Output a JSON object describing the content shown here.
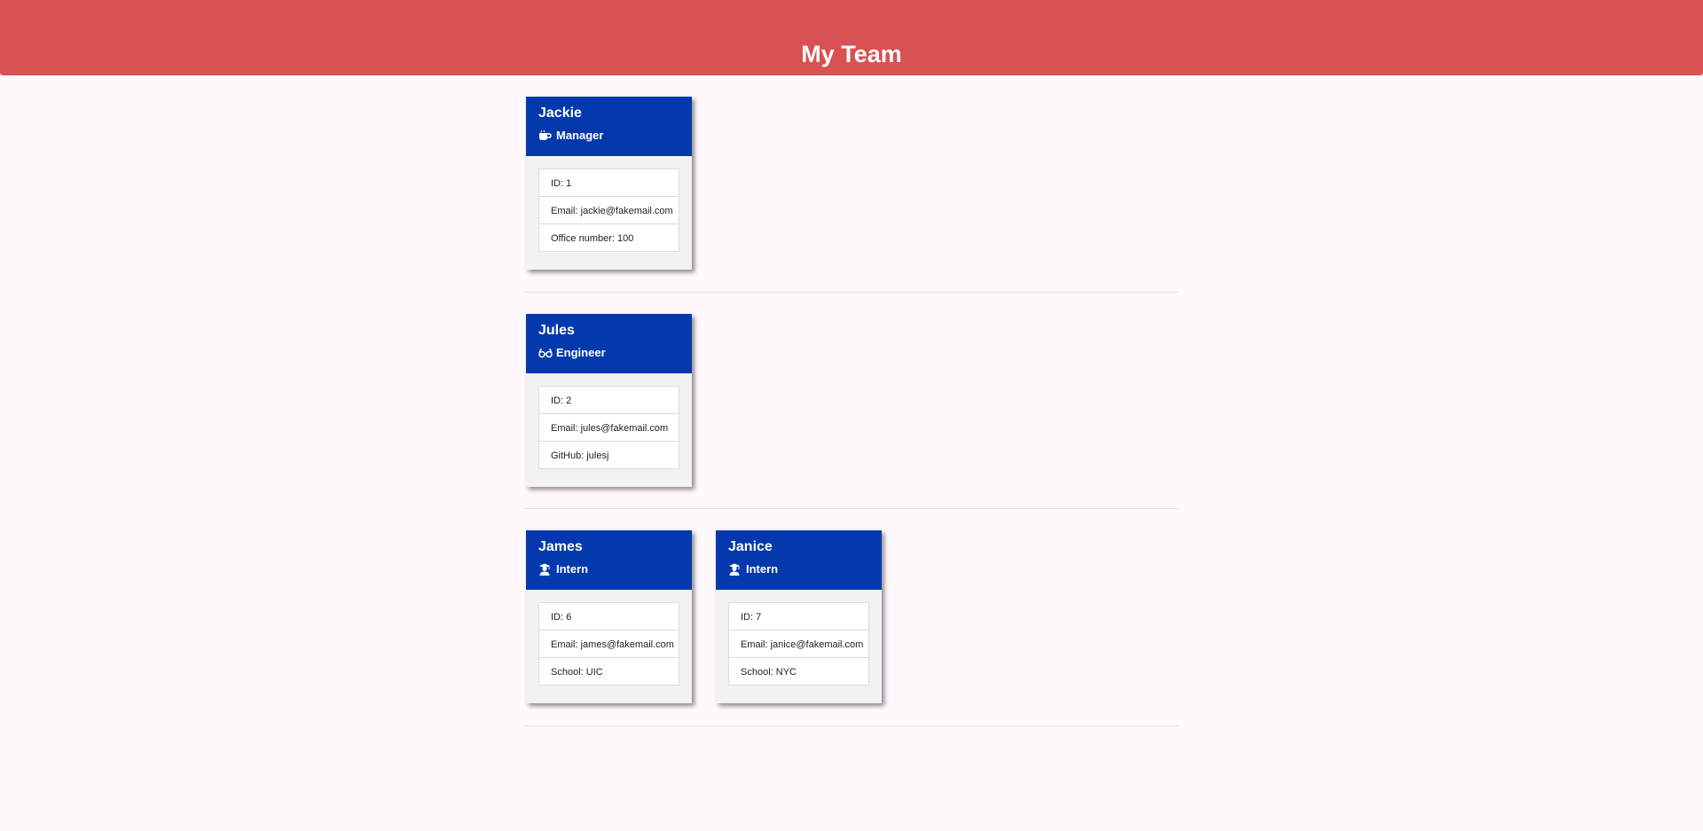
{
  "header": {
    "title": "My Team"
  },
  "rows": [
    {
      "cards": [
        {
          "name": "Jackie",
          "role": "Manager",
          "icon": "coffee-icon",
          "items": [
            "ID: 1",
            "Email: jackie@fakemail.com",
            "Office number: 100"
          ]
        }
      ]
    },
    {
      "cards": [
        {
          "name": "Jules",
          "role": "Engineer",
          "icon": "glasses-icon",
          "items": [
            "ID: 2",
            "Email: jules@fakemail.com",
            "GitHub: julesj"
          ]
        }
      ]
    },
    {
      "cards": [
        {
          "name": "James",
          "role": "Intern",
          "icon": "graduate-icon",
          "items": [
            "ID: 6",
            "Email: james@fakemail.com",
            "School: UIC"
          ]
        },
        {
          "name": "Janice",
          "role": "Intern",
          "icon": "graduate-icon",
          "items": [
            "ID: 7",
            "Email: janice@fakemail.com",
            "School: NYC"
          ]
        }
      ]
    }
  ],
  "colors": {
    "header_bg": "#d95152",
    "card_header_bg": "#0439ad",
    "page_bg": "#fff8fd"
  }
}
